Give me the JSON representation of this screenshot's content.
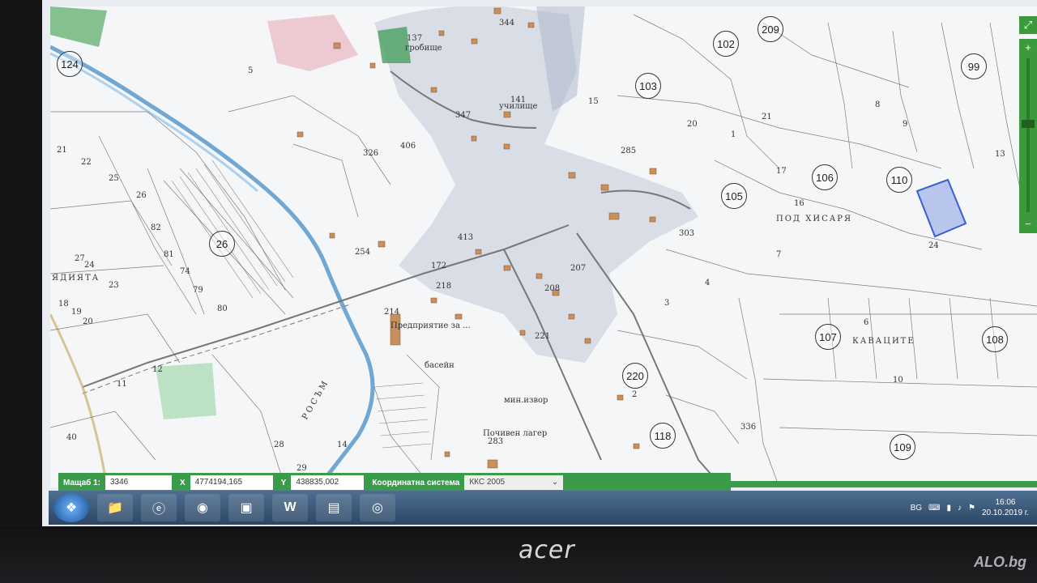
{
  "map": {
    "circled_ids": [
      "124",
      "102",
      "209",
      "99",
      "103",
      "106",
      "110",
      "105",
      "26",
      "107",
      "108",
      "220",
      "118",
      "109"
    ],
    "place_names": [
      "ПОД ХИСАРЯ",
      "КАВАЦИТЕ",
      "ЯДИЯТА",
      "гробище",
      "училище",
      "басейн",
      "Почивен лагер",
      "мин.извор",
      "Предприятие за ...",
      "РОСЪМ"
    ],
    "parcel_numbers": [
      "344",
      "137",
      "141",
      "347",
      "406",
      "326",
      "285",
      "303",
      "413",
      "172",
      "218",
      "207",
      "208",
      "221",
      "214",
      "254",
      "283",
      "336",
      "82",
      "81",
      "74",
      "79",
      "80",
      "25",
      "26",
      "27",
      "24",
      "23",
      "22",
      "21",
      "19",
      "20",
      "18",
      "12",
      "11",
      "40",
      "28",
      "29",
      "14",
      "1",
      "2",
      "3",
      "4",
      "5",
      "6",
      "7",
      "8",
      "9",
      "10",
      "13",
      "15",
      "16",
      "17",
      "24",
      "20",
      "21"
    ],
    "zoom_in": "+",
    "zoom_out": "−",
    "fullscreen": "⤢",
    "highlight_color": "#3a5fd0"
  },
  "statusbar": {
    "scale_label": "Мащаб  1:",
    "scale_value": "3346",
    "x_label": "X",
    "x_value": "4774194,165",
    "y_label": "Y",
    "y_value": "438835,002",
    "coord_label": "Координатна система",
    "coord_value": "ККС 2005"
  },
  "taskbar": {
    "apps": [
      "folder-icon",
      "ie-icon",
      "firefox-icon",
      "photos-icon",
      "word-icon",
      "document-icon",
      "chrome-icon"
    ],
    "language": "BG",
    "time": "16:06",
    "date": "20.10.2019 г."
  },
  "laptop": {
    "brand": "acer",
    "watermark": "ALO.bg"
  }
}
